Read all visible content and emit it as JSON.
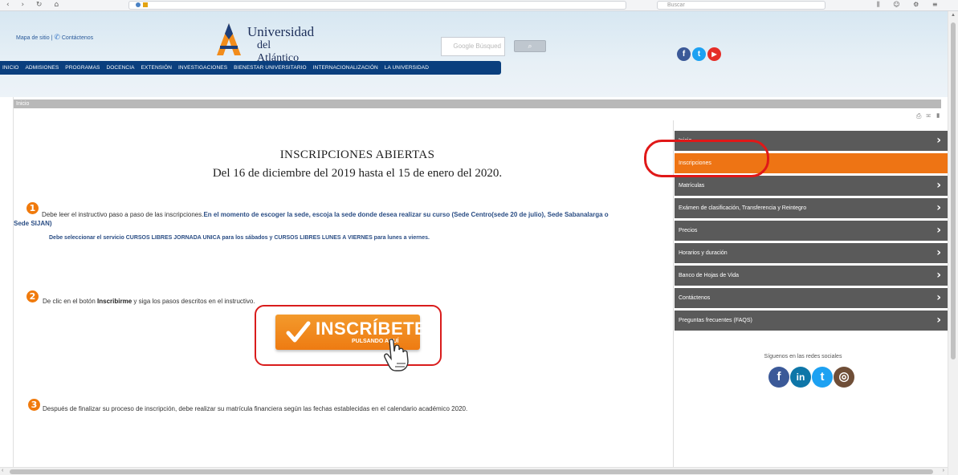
{
  "browser": {
    "nav_glyphs": "‹ › ↻ ⌂",
    "search_placeholder": "Buscar",
    "tool_glyphs": "⫼ ☺ ⚙ ≡"
  },
  "header": {
    "site_map_label": "Mapa de sitio",
    "separator": "|",
    "contact_label": "Contáctenos",
    "university_name_line1": "Universidad",
    "university_name_line2": "del Atlántico",
    "search_placeholder": "Google Búsqued",
    "search_button_icon": "search-icon",
    "nav_items": [
      "INICIO",
      "ADMISIONES",
      "PROGRAMAS",
      "DOCENCIA",
      "EXTENSIÓN",
      "INVESTIGACIONES",
      "BIENESTAR UNIVERSITARIO",
      "INTERNACIONALIZACIÓN",
      "LA UNIVERSIDAD"
    ],
    "social_icons": [
      {
        "name": "facebook-icon",
        "glyph": "f",
        "color": "#3b5998"
      },
      {
        "name": "twitter-icon",
        "glyph": "t",
        "color": "#1da1f2"
      },
      {
        "name": "youtube-icon",
        "glyph": "▶",
        "color": "#e52d27"
      }
    ]
  },
  "breadcrumb": {
    "label": "Inicio"
  },
  "main": {
    "title": "INSCRIPCIONES ABIERTAS",
    "subtitle": "Del 16 de diciembre del 2019 hasta el 15 de enero del 2020.",
    "step1": {
      "number": "1",
      "text_plain": "Debe leer el instructivo paso a paso de las inscripciones.",
      "text_bold": "En el momento de escoger la sede, escoja la sede donde desea realizar su curso (Sede Centro(sede 20 de julio), Sede Sabanalarga o",
      "text_bold_cont": "Sede SIJAN)",
      "note": "Debe seleccionar el servicio CURSOS LIBRES JORNADA UNICA  para los sábados y CURSOS LIBRES LUNES A VIERNES  para lunes a viernes."
    },
    "step2": {
      "number": "2",
      "text_before": "De clic en el botón ",
      "text_bold": "Inscribirme",
      "text_after": " y siga los pasos descritos en el instructivo."
    },
    "button": {
      "label": "INSCRÍBETE",
      "sublabel": "PULSANDO AQUÍ"
    },
    "step3": {
      "number": "3",
      "text": "Después de finalizar su proceso de inscripción, debe realizar su matrícula financiera según las fechas establecidas en el calendario académico 2020."
    }
  },
  "sidebar": {
    "items": [
      {
        "label": "Inicio",
        "active": false
      },
      {
        "label": "Inscripciones",
        "active": true
      },
      {
        "label": "Matrículas",
        "active": false
      },
      {
        "label": "Exámen de clasificación, Transferencia y Reintegro",
        "active": false
      },
      {
        "label": "Precios",
        "active": false
      },
      {
        "label": "Horarios y duración",
        "active": false
      },
      {
        "label": "Banco de Hojas de Vida",
        "active": false
      },
      {
        "label": "Contáctenos",
        "active": false
      },
      {
        "label": "Preguntas frecuentes (FAQS)",
        "active": false
      }
    ],
    "follow_label": "Síguenos en las redes sociales",
    "social_icons": [
      {
        "name": "facebook-icon",
        "glyph": "f",
        "color": "#3b5998"
      },
      {
        "name": "linkedin-icon",
        "glyph": "in",
        "color": "#0e76a8"
      },
      {
        "name": "twitter-icon",
        "glyph": "t",
        "color": "#1da1f2"
      },
      {
        "name": "instagram-icon",
        "glyph": "◎",
        "color": "#6f4e37"
      }
    ]
  },
  "colors": {
    "accent_orange": "#ee7414",
    "nav_blue": "#0a3f7e",
    "highlight_red": "#e01818",
    "sidebar_gray": "#5a5a5a"
  }
}
